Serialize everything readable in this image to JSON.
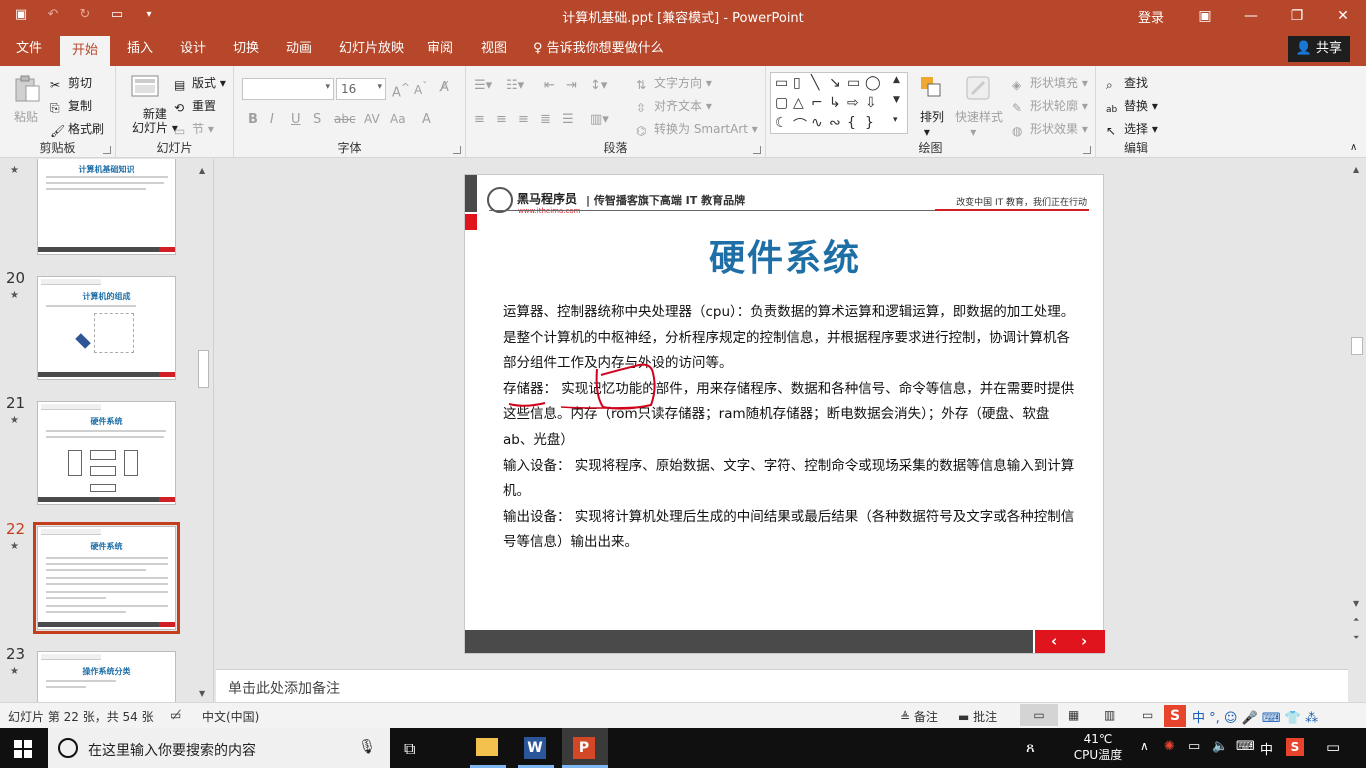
{
  "window": {
    "title": "计算机基础.ppt [兼容模式]  -  PowerPoint",
    "login": "登录"
  },
  "tabs": [
    {
      "label": "文件"
    },
    {
      "label": "开始"
    },
    {
      "label": "插入"
    },
    {
      "label": "设计"
    },
    {
      "label": "切换"
    },
    {
      "label": "动画"
    },
    {
      "label": "幻灯片放映"
    },
    {
      "label": "审阅"
    },
    {
      "label": "视图"
    }
  ],
  "tellme": "告诉我你想要做什么",
  "share": "共享",
  "ribbon": {
    "clipboard": {
      "label": "剪贴板",
      "paste": "粘贴",
      "cut": "剪切",
      "copy": "复制",
      "format_painter": "格式刷"
    },
    "slides": {
      "label": "幻灯片",
      "new_slide": "新建\n幻灯片",
      "new_slide_l1": "新建",
      "new_slide_l2": "幻灯片",
      "layout": "版式",
      "reset": "重置",
      "section": "节"
    },
    "font": {
      "label": "字体",
      "font_name": "",
      "font_size": "16"
    },
    "paragraph": {
      "label": "段落",
      "text_direction": "文字方向",
      "align_text": "对齐文本",
      "smartart": "转换为 SmartArt"
    },
    "drawing": {
      "label": "绘图",
      "arrange": "排列",
      "quick_styles": "快速样式",
      "shape_fill": "形状填充",
      "shape_outline": "形状轮廓",
      "shape_effects": "形状效果"
    },
    "editing": {
      "label": "编辑",
      "find": "查找",
      "replace": "替换",
      "select": "选择"
    }
  },
  "thumbnails": [
    {
      "num": "",
      "title": "计算机基础知识"
    },
    {
      "num": "20",
      "title": "计算机的组成"
    },
    {
      "num": "21",
      "title": "硬件系统"
    },
    {
      "num": "22",
      "title": "硬件系统"
    },
    {
      "num": "23",
      "title": "操作系统分类"
    }
  ],
  "slide": {
    "logo_name": "黑马程序员",
    "logo_url": "www.itheima.com",
    "brand": "| 传智播客旗下高端 IT 教育品牌",
    "slogan": "改变中国 IT 教育，我们正在行动",
    "title": "硬件系统",
    "paragraphs": [
      "运算器、控制器统称中央处理器（cpu）：负责数据的算术运算和逻辑运算，即数据的加工处理。是整个计算机的中枢神经，分析程序规定的控制信息，并根据程序要求进行控制，协调计算机各部分组件工作及内存与外设的访问等。",
      "存储器：  实现记忆功能的部件，用来存储程序、数据和各种信号、命令等信息，并在需要时提供这些信息。内存（rom只读存储器；ram随机存储器；断电数据会消失）；外存（硬盘、软盘ab、光盘）",
      "输入设备：  实现将程序、原始数据、文字、字符、控制命令或现场采集的数据等信息输入到计算机。",
      "输出设备：  实现将计算机处理后生成的中间结果或最后结果（各种数据符号及文字或各种控制信号等信息）输出出来。"
    ],
    "nav_prev": "‹",
    "nav_next": "›"
  },
  "notes_placeholder": "单击此处添加备注",
  "status": {
    "slide_info": "幻灯片 第 22 张，共 54 张",
    "language": "中文(中国)",
    "notes": "备注",
    "comments": "批注"
  },
  "taskbar": {
    "search_placeholder": "在这里输入你要搜索的内容",
    "temp": "41℃",
    "temp_label": "CPU温度",
    "ime": "中"
  },
  "colors": {
    "accent": "#b7472a",
    "slide_title": "#1f6fa7",
    "brand_red": "#e0141c"
  }
}
